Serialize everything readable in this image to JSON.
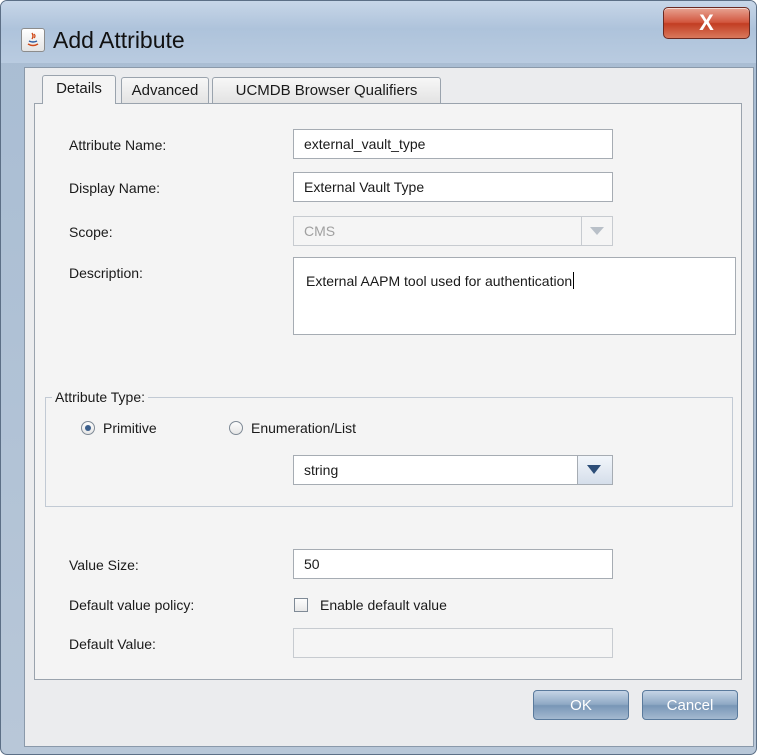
{
  "window": {
    "title": "Add Attribute",
    "close_glyph": "X",
    "icon": "java-icon"
  },
  "tabs": [
    {
      "label": "Details",
      "active": true
    },
    {
      "label": "Advanced",
      "active": false
    },
    {
      "label": "UCMDB Browser Qualifiers",
      "active": false
    }
  ],
  "form": {
    "attribute_name_label": "Attribute Name:",
    "attribute_name_value": "external_vault_type",
    "display_name_label": "Display Name:",
    "display_name_value": "External Vault Type",
    "scope_label": "Scope:",
    "scope_value": "CMS",
    "description_label": "Description:",
    "description_value": "External AAPM tool used for authentication",
    "attribute_type_title": "Attribute Type:",
    "primitive_label": "Primitive",
    "enumeration_label": "Enumeration/List",
    "type_value": "string",
    "value_size_label": "Value Size:",
    "value_size_value": "50",
    "default_policy_label": "Default value policy:",
    "enable_default_label": "Enable default value",
    "default_value_label": "Default Value:",
    "default_value_value": ""
  },
  "buttons": {
    "ok": "OK",
    "cancel": "Cancel"
  },
  "colors": {
    "titlebar": "#b9cbe0",
    "close_button": "#c23d22",
    "button": "#8ea8c4",
    "panel": "#f4f4f4"
  }
}
